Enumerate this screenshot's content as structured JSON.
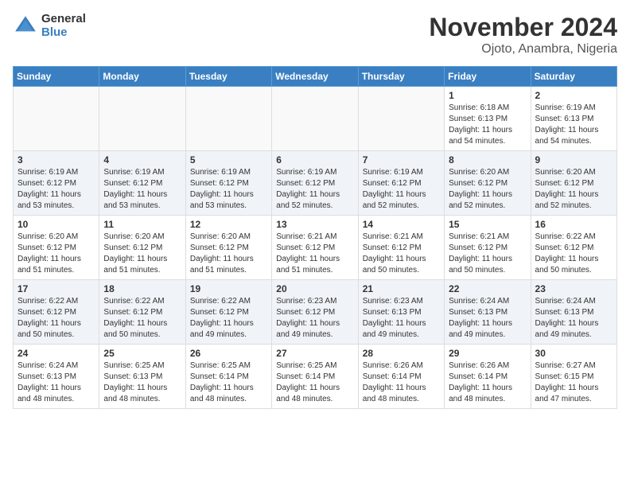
{
  "logo": {
    "general": "General",
    "blue": "Blue"
  },
  "title": "November 2024",
  "subtitle": "Ojoto, Anambra, Nigeria",
  "weekdays": [
    "Sunday",
    "Monday",
    "Tuesday",
    "Wednesday",
    "Thursday",
    "Friday",
    "Saturday"
  ],
  "weeks": [
    [
      {
        "day": "",
        "info": ""
      },
      {
        "day": "",
        "info": ""
      },
      {
        "day": "",
        "info": ""
      },
      {
        "day": "",
        "info": ""
      },
      {
        "day": "",
        "info": ""
      },
      {
        "day": "1",
        "info": "Sunrise: 6:18 AM\nSunset: 6:13 PM\nDaylight: 11 hours\nand 54 minutes."
      },
      {
        "day": "2",
        "info": "Sunrise: 6:19 AM\nSunset: 6:13 PM\nDaylight: 11 hours\nand 54 minutes."
      }
    ],
    [
      {
        "day": "3",
        "info": "Sunrise: 6:19 AM\nSunset: 6:12 PM\nDaylight: 11 hours\nand 53 minutes."
      },
      {
        "day": "4",
        "info": "Sunrise: 6:19 AM\nSunset: 6:12 PM\nDaylight: 11 hours\nand 53 minutes."
      },
      {
        "day": "5",
        "info": "Sunrise: 6:19 AM\nSunset: 6:12 PM\nDaylight: 11 hours\nand 53 minutes."
      },
      {
        "day": "6",
        "info": "Sunrise: 6:19 AM\nSunset: 6:12 PM\nDaylight: 11 hours\nand 52 minutes."
      },
      {
        "day": "7",
        "info": "Sunrise: 6:19 AM\nSunset: 6:12 PM\nDaylight: 11 hours\nand 52 minutes."
      },
      {
        "day": "8",
        "info": "Sunrise: 6:20 AM\nSunset: 6:12 PM\nDaylight: 11 hours\nand 52 minutes."
      },
      {
        "day": "9",
        "info": "Sunrise: 6:20 AM\nSunset: 6:12 PM\nDaylight: 11 hours\nand 52 minutes."
      }
    ],
    [
      {
        "day": "10",
        "info": "Sunrise: 6:20 AM\nSunset: 6:12 PM\nDaylight: 11 hours\nand 51 minutes."
      },
      {
        "day": "11",
        "info": "Sunrise: 6:20 AM\nSunset: 6:12 PM\nDaylight: 11 hours\nand 51 minutes."
      },
      {
        "day": "12",
        "info": "Sunrise: 6:20 AM\nSunset: 6:12 PM\nDaylight: 11 hours\nand 51 minutes."
      },
      {
        "day": "13",
        "info": "Sunrise: 6:21 AM\nSunset: 6:12 PM\nDaylight: 11 hours\nand 51 minutes."
      },
      {
        "day": "14",
        "info": "Sunrise: 6:21 AM\nSunset: 6:12 PM\nDaylight: 11 hours\nand 50 minutes."
      },
      {
        "day": "15",
        "info": "Sunrise: 6:21 AM\nSunset: 6:12 PM\nDaylight: 11 hours\nand 50 minutes."
      },
      {
        "day": "16",
        "info": "Sunrise: 6:22 AM\nSunset: 6:12 PM\nDaylight: 11 hours\nand 50 minutes."
      }
    ],
    [
      {
        "day": "17",
        "info": "Sunrise: 6:22 AM\nSunset: 6:12 PM\nDaylight: 11 hours\nand 50 minutes."
      },
      {
        "day": "18",
        "info": "Sunrise: 6:22 AM\nSunset: 6:12 PM\nDaylight: 11 hours\nand 50 minutes."
      },
      {
        "day": "19",
        "info": "Sunrise: 6:22 AM\nSunset: 6:12 PM\nDaylight: 11 hours\nand 49 minutes."
      },
      {
        "day": "20",
        "info": "Sunrise: 6:23 AM\nSunset: 6:12 PM\nDaylight: 11 hours\nand 49 minutes."
      },
      {
        "day": "21",
        "info": "Sunrise: 6:23 AM\nSunset: 6:13 PM\nDaylight: 11 hours\nand 49 minutes."
      },
      {
        "day": "22",
        "info": "Sunrise: 6:24 AM\nSunset: 6:13 PM\nDaylight: 11 hours\nand 49 minutes."
      },
      {
        "day": "23",
        "info": "Sunrise: 6:24 AM\nSunset: 6:13 PM\nDaylight: 11 hours\nand 49 minutes."
      }
    ],
    [
      {
        "day": "24",
        "info": "Sunrise: 6:24 AM\nSunset: 6:13 PM\nDaylight: 11 hours\nand 48 minutes."
      },
      {
        "day": "25",
        "info": "Sunrise: 6:25 AM\nSunset: 6:13 PM\nDaylight: 11 hours\nand 48 minutes."
      },
      {
        "day": "26",
        "info": "Sunrise: 6:25 AM\nSunset: 6:14 PM\nDaylight: 11 hours\nand 48 minutes."
      },
      {
        "day": "27",
        "info": "Sunrise: 6:25 AM\nSunset: 6:14 PM\nDaylight: 11 hours\nand 48 minutes."
      },
      {
        "day": "28",
        "info": "Sunrise: 6:26 AM\nSunset: 6:14 PM\nDaylight: 11 hours\nand 48 minutes."
      },
      {
        "day": "29",
        "info": "Sunrise: 6:26 AM\nSunset: 6:14 PM\nDaylight: 11 hours\nand 48 minutes."
      },
      {
        "day": "30",
        "info": "Sunrise: 6:27 AM\nSunset: 6:15 PM\nDaylight: 11 hours\nand 47 minutes."
      }
    ]
  ]
}
